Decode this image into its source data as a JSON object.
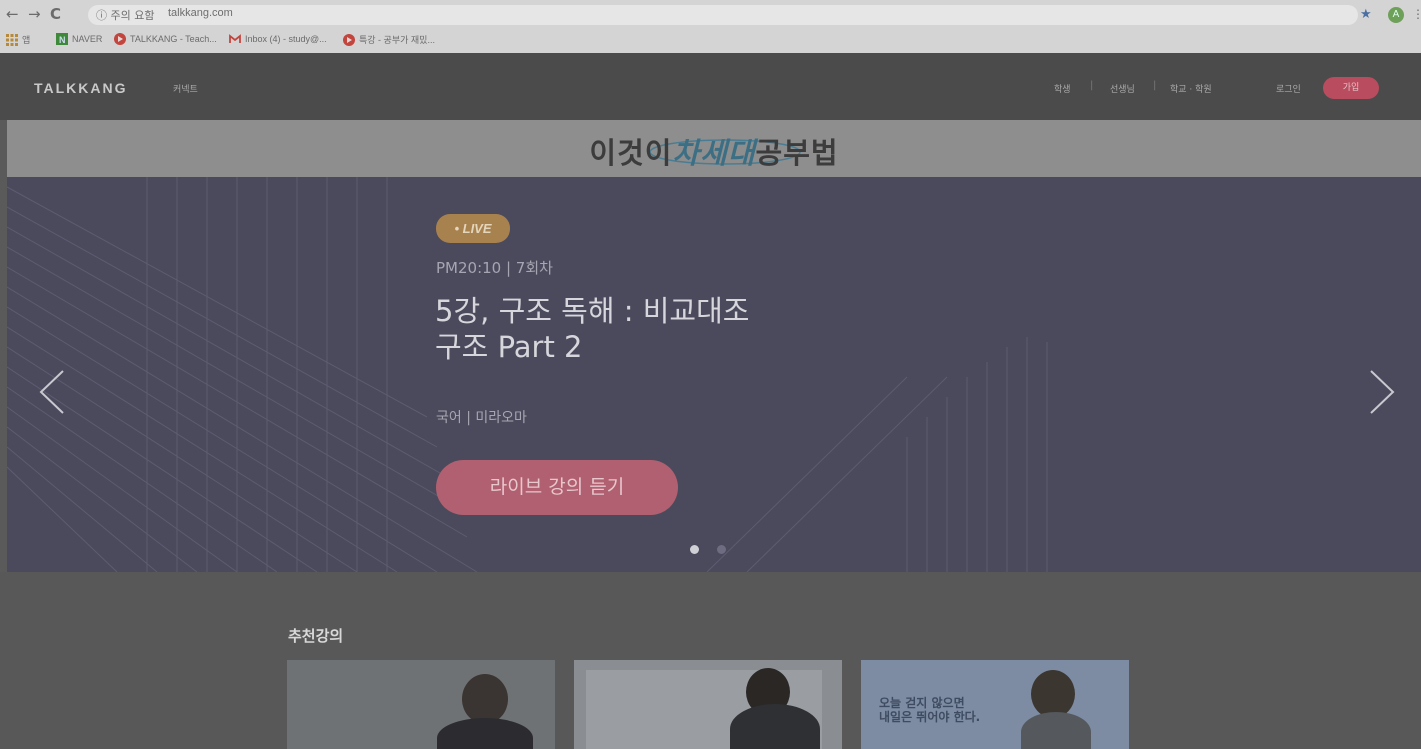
{
  "browser": {
    "nav_back": "←",
    "nav_forward": "→",
    "nav_reload": "C",
    "security": "ⓘ 주의 요함",
    "url": "talkkang.com",
    "star_icon": "★",
    "avatar_letter": "A",
    "bookmarks": [
      {
        "icon": "apps-icon",
        "label": "앱"
      },
      {
        "icon": "naver-icon",
        "label": "NAVER"
      },
      {
        "icon": "talkkang-icon",
        "label": "TALKKANG - Teach..."
      },
      {
        "icon": "gmail-icon",
        "label": "Inbox (4) - study@..."
      },
      {
        "icon": "talkkang-icon",
        "label": "특강 - 공부가 재밌..."
      }
    ]
  },
  "header": {
    "logo": "TALKKANG",
    "connect": "커넥트",
    "links": [
      "학생",
      "선생님",
      "학교 · 학원"
    ],
    "login": "로그인",
    "join": "가입"
  },
  "banner": {
    "prefix": "이것이",
    "emphasis": "차세대",
    "suffix": "공부법"
  },
  "hero": {
    "badge": "• LIVE",
    "meta": "PM20:10 | 7회차",
    "title_line1": "5강, 구조 독해 : 비교대조",
    "title_line2": "구조 Part 2",
    "subtitle": "국어 | 미라오마",
    "cta": "라이브 강의 듣기",
    "slide_count": 2,
    "active_slide": 1
  },
  "recommended": {
    "title": "추천강의",
    "card3_text_line1": "오늘 걷지 않으면",
    "card3_text_line2": "내일은 뛰어야 한다."
  },
  "colors": {
    "accent_pink": "#b94c5e",
    "live_gold": "#a8824e",
    "hero_bg": "#4b4a5c"
  }
}
